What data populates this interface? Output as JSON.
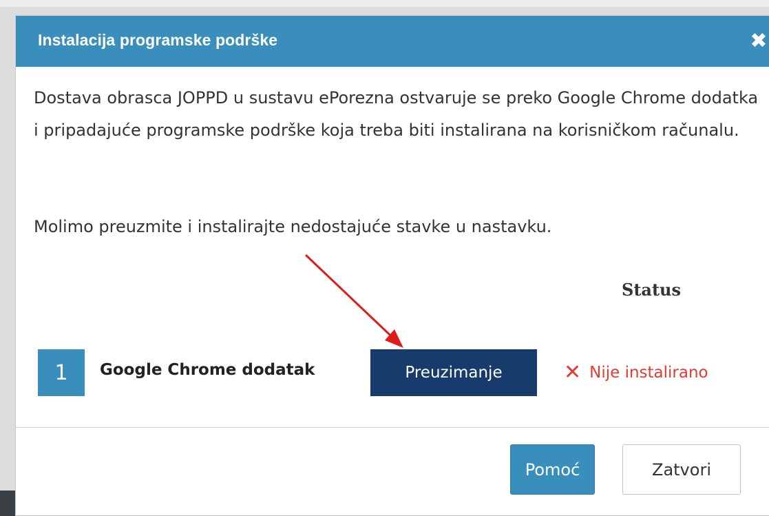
{
  "dialog": {
    "title": "Instalacija programske podrške",
    "close_icon": "close-icon",
    "close_glyph": "✖"
  },
  "body": {
    "intro": "Dostava obrasca JOPPD u sustavu ePorezna ostvaruje se preko Google Chrome dodatka i pripadajuće programske podrške koja treba biti instalirana na korisničkom računalu.",
    "request": "Molimo preuzmite i instalirajte nedostajuće stavke u nastavku.",
    "status_heading": "Status"
  },
  "items": [
    {
      "number": "1",
      "name": "Google Chrome dodatak",
      "download_label": "Preuzimanje",
      "status_icon": "x-icon",
      "status_glyph": "✕",
      "status_text": "Nije instalirano"
    }
  ],
  "footer": {
    "help_label": "Pomoć",
    "close_label": "Zatvori"
  },
  "colors": {
    "header": "#3a8ebb",
    "download_button": "#173b6c",
    "status_error": "#e23b32",
    "annotation_arrow": "#e01b1b"
  }
}
